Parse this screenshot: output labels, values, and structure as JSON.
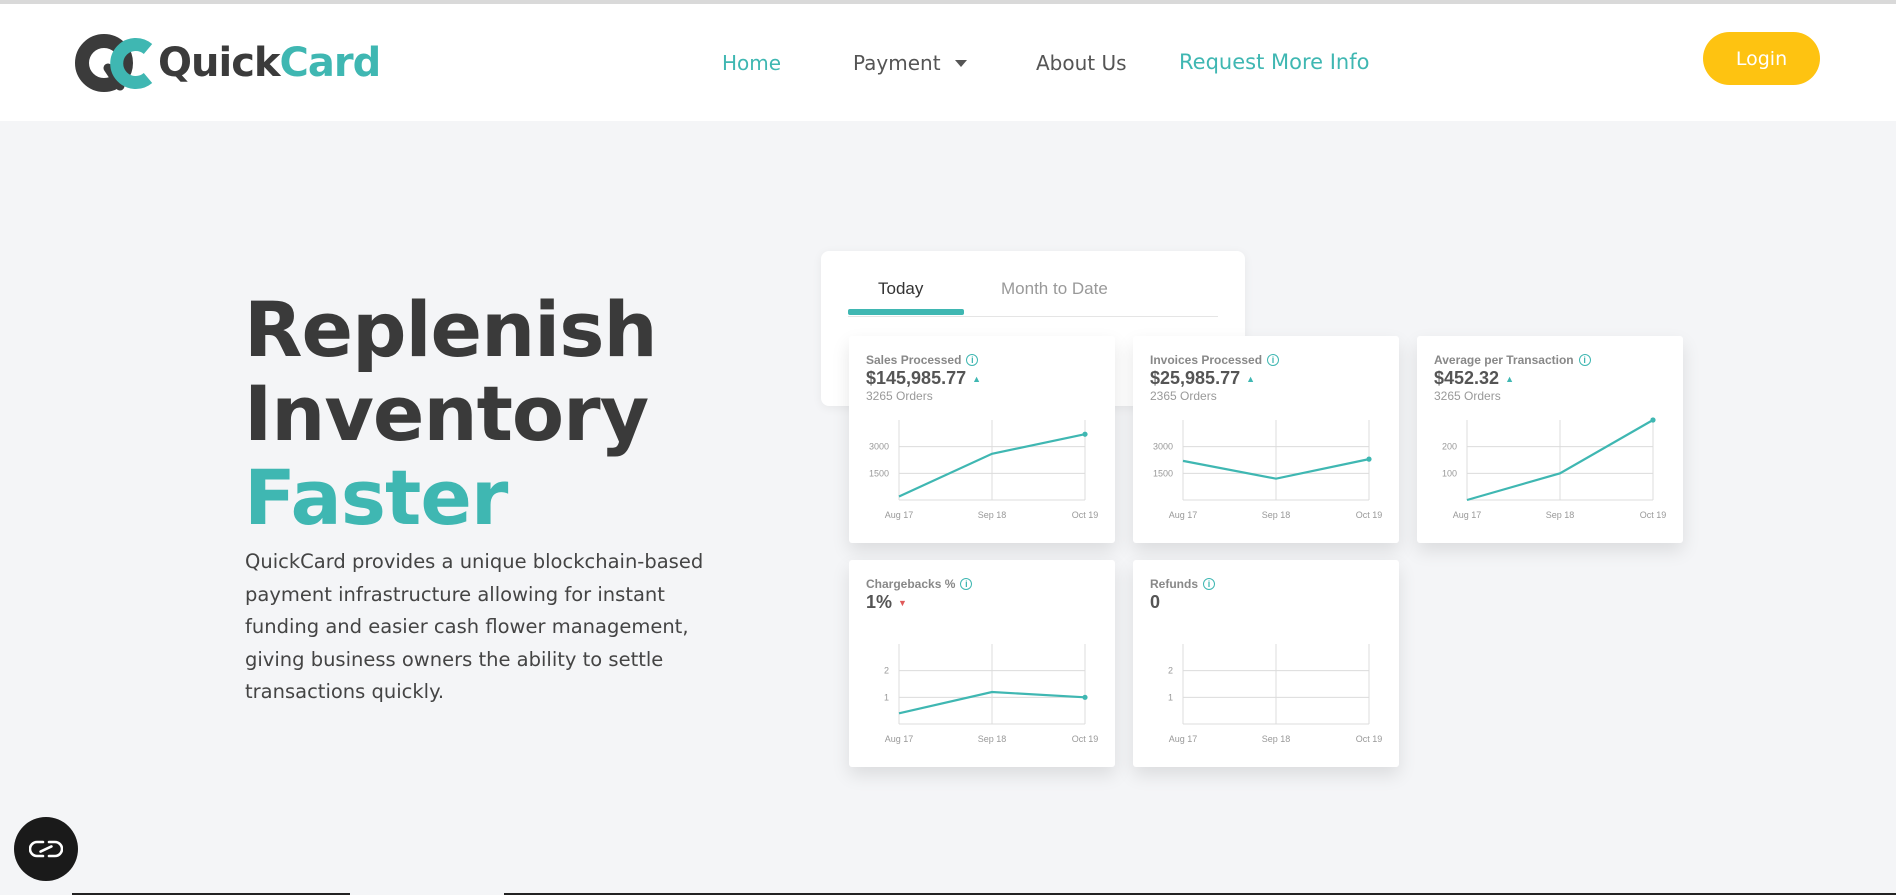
{
  "brand": {
    "quick": "Quick",
    "card": "Card",
    "logo_icon": "quickcard-logo-icon"
  },
  "nav": {
    "home": "Home",
    "payment": "Payment",
    "about": "About Us",
    "request_info": "Request More Info"
  },
  "login_label": "Login",
  "hero": {
    "line1": "Replenish",
    "line2": "Inventory",
    "line3": "Faster",
    "description": "QuickCard provides a unique blockchain-based payment infrastructure allowing for instant funding and easier cash flower management, giving business owners the ability to settle transactions quickly."
  },
  "dashboard": {
    "tabs": [
      "Today",
      "Month to Date"
    ],
    "active_tab": "Today",
    "cards": [
      {
        "title": "Sales Processed",
        "value": "$145,985.77",
        "trend": "up",
        "orders": "3265 Orders"
      },
      {
        "title": "Invoices Processed",
        "value": "$25,985.77",
        "trend": "up",
        "orders": "2365 Orders"
      },
      {
        "title": "Average per Transaction",
        "value": "$452.32",
        "trend": "up",
        "orders": "3265 Orders"
      },
      {
        "title": "Chargebacks %",
        "value": "1%",
        "trend": "down",
        "orders": ""
      },
      {
        "title": "Refunds",
        "value": "0",
        "trend": "",
        "orders": ""
      }
    ]
  },
  "chart_data": [
    {
      "type": "line",
      "title": "Sales Processed",
      "x": [
        "Aug 17",
        "Sep 18",
        "Oct 19"
      ],
      "yticks": [
        "1500",
        "3000"
      ],
      "ylim": [
        0,
        4500
      ],
      "values": [
        200,
        2600,
        3700
      ]
    },
    {
      "type": "line",
      "title": "Invoices Processed",
      "x": [
        "Aug 17",
        "Sep 18",
        "Oct 19"
      ],
      "yticks": [
        "1500",
        "3000"
      ],
      "ylim": [
        0,
        4500
      ],
      "values": [
        2200,
        1200,
        2300
      ]
    },
    {
      "type": "line",
      "title": "Average per Transaction",
      "x": [
        "Aug 17",
        "Sep 18",
        "Oct 19"
      ],
      "yticks": [
        "100",
        "200"
      ],
      "ylim": [
        0,
        300
      ],
      "values": [
        0,
        100,
        300
      ]
    },
    {
      "type": "line",
      "title": "Chargebacks %",
      "x": [
        "Aug 17",
        "Sep 18",
        "Oct 19"
      ],
      "yticks": [
        "1",
        "2"
      ],
      "ylim": [
        0,
        3
      ],
      "values": [
        0.4,
        1.2,
        1.0
      ]
    },
    {
      "type": "line",
      "title": "Refunds",
      "x": [
        "Aug 17",
        "Sep 18",
        "Oct 19"
      ],
      "yticks": [
        "1",
        "2"
      ],
      "ylim": [
        0,
        3
      ],
      "values": []
    }
  ],
  "colors": {
    "accent": "#3fb7b2",
    "login": "#fec311",
    "trend_down": "#e05a5a"
  },
  "chat_icon": "chat-icon"
}
